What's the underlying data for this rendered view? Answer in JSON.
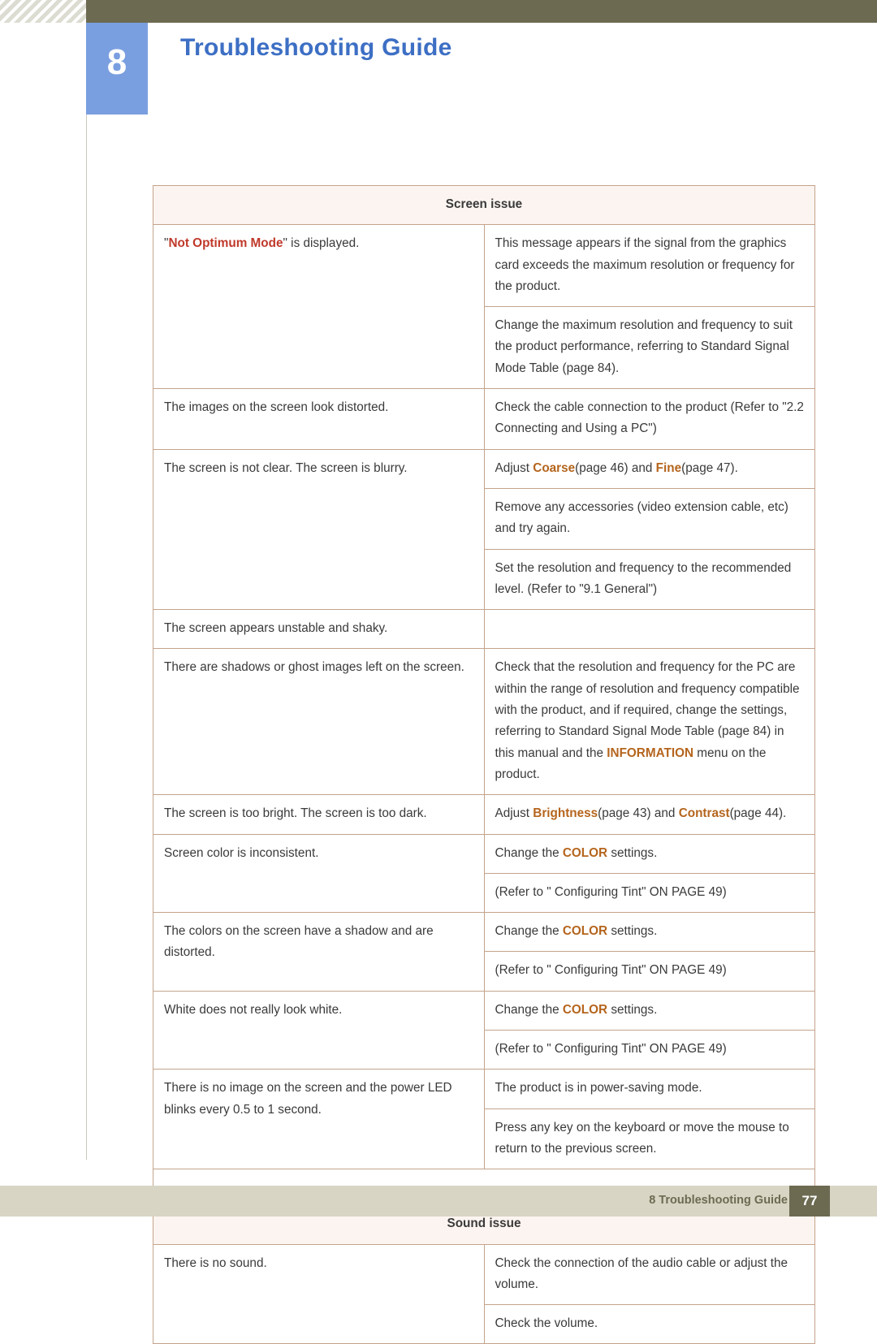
{
  "header": {
    "chapter_number": "8",
    "title": "Troubleshooting Guide"
  },
  "footer": {
    "label": "8 Troubleshooting Guide",
    "page_number": "77"
  },
  "sections": [
    {
      "heading": "Screen issue",
      "rows": [
        {
          "symptom_parts": [
            {
              "text": "\"",
              "style": "plain"
            },
            {
              "text": "Not Optimum Mode",
              "style": "hl"
            },
            {
              "text": "\" is displayed.",
              "style": "plain"
            }
          ],
          "solutions": [
            [
              {
                "text": "This message appears if the signal from the graphics card exceeds the maximum resolution or frequency for the product.",
                "style": "plain"
              }
            ],
            [
              {
                "text": "Change the maximum resolution and frequency to suit the product performance, referring to Standard Signal Mode Table (page 84).",
                "style": "plain"
              }
            ]
          ]
        },
        {
          "symptom_parts": [
            {
              "text": "The images on the screen look distorted.",
              "style": "plain"
            }
          ],
          "solutions": [
            [
              {
                "text": "Check the cable connection to the product (Refer to \"2.2 Connecting and Using a PC\")",
                "style": "plain"
              }
            ]
          ]
        },
        {
          "symptom_parts": [
            {
              "text": "The screen is not clear. The screen is blurry.",
              "style": "plain"
            }
          ],
          "solutions": [
            [
              {
                "text": "Adjust ",
                "style": "plain"
              },
              {
                "text": "Coarse",
                "style": "hl2"
              },
              {
                "text": "(page 46) and ",
                "style": "plain"
              },
              {
                "text": "Fine",
                "style": "hl2"
              },
              {
                "text": "(page 47).",
                "style": "plain"
              }
            ],
            [
              {
                "text": "Remove any accessories (video extension cable, etc) and try again.",
                "style": "plain"
              }
            ],
            [
              {
                "text": "Set the resolution and frequency to the recommended level. (Refer to \"9.1 General\")",
                "style": "plain"
              }
            ]
          ]
        },
        {
          "symptom_parts": [
            {
              "text": "The screen appears unstable and shaky.",
              "style": "plain"
            }
          ],
          "solutions": []
        },
        {
          "symptom_parts": [
            {
              "text": "There are shadows or ghost images left on the screen.",
              "style": "plain"
            }
          ],
          "solutions": [
            [
              {
                "text": "Check that the resolution and frequency for the PC are within the range of resolution and frequency compatible with the product, and if required, change the settings, referring to Standard Signal Mode Table (page 84) in this manual and the ",
                "style": "plain"
              },
              {
                "text": "INFORMATION",
                "style": "hl2"
              },
              {
                "text": " menu on the product.",
                "style": "plain"
              }
            ]
          ]
        },
        {
          "symptom_parts": [
            {
              "text": "The screen is too bright. The screen is too dark.",
              "style": "plain"
            }
          ],
          "solutions": [
            [
              {
                "text": "Adjust ",
                "style": "plain"
              },
              {
                "text": "Brightness",
                "style": "hl2"
              },
              {
                "text": "(page 43) and ",
                "style": "plain"
              },
              {
                "text": "Contrast",
                "style": "hl2"
              },
              {
                "text": "(page 44).",
                "style": "plain"
              }
            ]
          ]
        },
        {
          "symptom_parts": [
            {
              "text": "Screen color is inconsistent.",
              "style": "plain"
            }
          ],
          "solutions": [
            [
              {
                "text": "Change the ",
                "style": "plain"
              },
              {
                "text": "COLOR",
                "style": "hl2"
              },
              {
                "text": " settings.",
                "style": "plain"
              }
            ],
            [
              {
                "text": "(Refer to \" Configuring Tint\" ON PAGE 49)",
                "style": "plain"
              }
            ]
          ]
        },
        {
          "symptom_parts": [
            {
              "text": "The colors on the screen have a shadow and are distorted.",
              "style": "plain"
            }
          ],
          "solutions": [
            [
              {
                "text": "Change the ",
                "style": "plain"
              },
              {
                "text": "COLOR",
                "style": "hl2"
              },
              {
                "text": " settings.",
                "style": "plain"
              }
            ],
            [
              {
                "text": "(Refer to \" Configuring Tint\" ON PAGE 49)",
                "style": "plain"
              }
            ]
          ]
        },
        {
          "symptom_parts": [
            {
              "text": "White does not really look white.",
              "style": "plain"
            }
          ],
          "solutions": [
            [
              {
                "text": "Change the ",
                "style": "plain"
              },
              {
                "text": "COLOR",
                "style": "hl2"
              },
              {
                "text": " settings.",
                "style": "plain"
              }
            ],
            [
              {
                "text": "(Refer to \" Configuring Tint\" ON PAGE 49)",
                "style": "plain"
              }
            ]
          ]
        },
        {
          "symptom_parts": [
            {
              "text": "There is no image on the screen and the power LED blinks every 0.5 to 1 second.",
              "style": "plain"
            }
          ],
          "solutions": [
            [
              {
                "text": "The product is in power-saving mode.",
                "style": "plain"
              }
            ],
            [
              {
                "text": "Press any key on the keyboard or move the mouse to return to the previous screen.",
                "style": "plain"
              }
            ]
          ]
        }
      ]
    },
    {
      "heading": "Sound issue",
      "rows": [
        {
          "symptom_parts": [
            {
              "text": "There is no sound.",
              "style": "plain"
            }
          ],
          "solutions": [
            [
              {
                "text": "Check the connection of the audio cable or adjust the volume.",
                "style": "plain"
              }
            ],
            [
              {
                "text": "Check the volume.",
                "style": "plain"
              }
            ]
          ]
        }
      ]
    }
  ]
}
